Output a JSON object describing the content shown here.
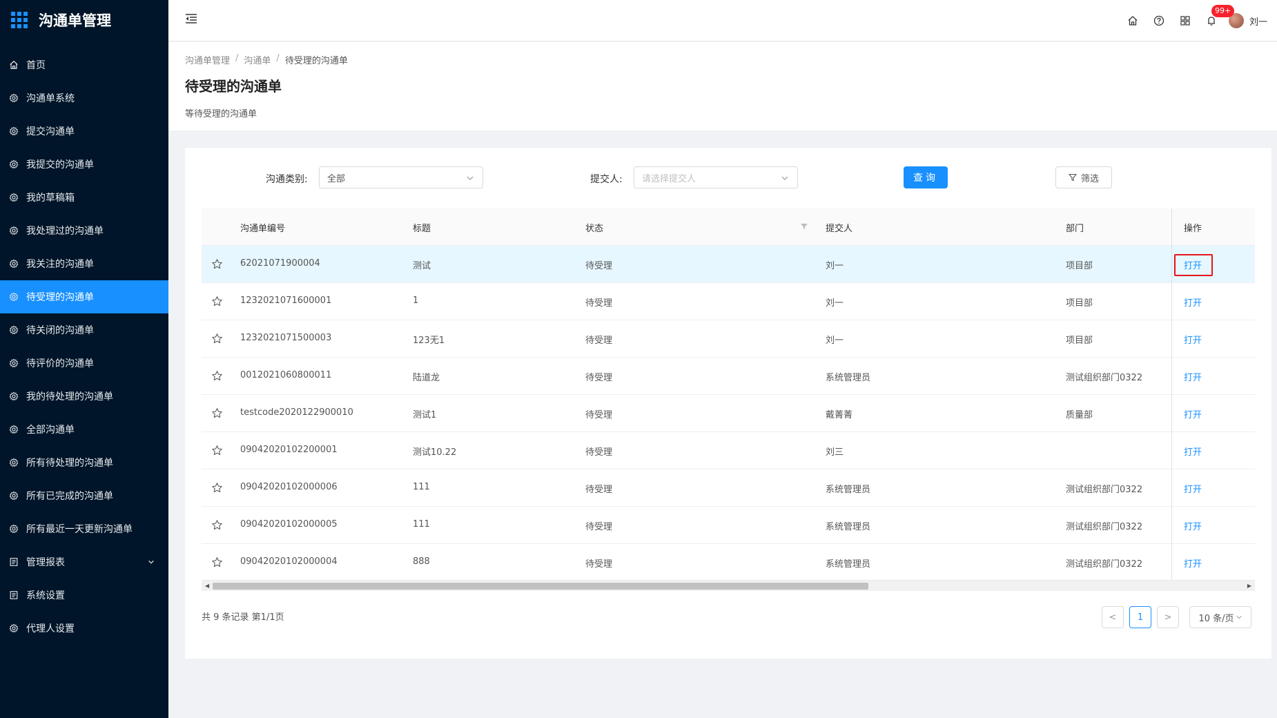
{
  "app": {
    "title": "沟通单管理"
  },
  "sidebar": {
    "items": [
      {
        "label": "首页",
        "icon": "home-icon"
      },
      {
        "label": "沟通单系统",
        "icon": "gear-icon"
      },
      {
        "label": "提交沟通单",
        "icon": "gear-icon"
      },
      {
        "label": "我提交的沟通单",
        "icon": "gear-icon"
      },
      {
        "label": "我的草稿箱",
        "icon": "gear-icon"
      },
      {
        "label": "我处理过的沟通单",
        "icon": "gear-icon"
      },
      {
        "label": "我关注的沟通单",
        "icon": "gear-icon"
      },
      {
        "label": "待受理的沟通单",
        "icon": "gear-icon",
        "active": true
      },
      {
        "label": "待关闭的沟通单",
        "icon": "gear-icon"
      },
      {
        "label": "待评价的沟通单",
        "icon": "gear-icon"
      },
      {
        "label": "我的待处理的沟通单",
        "icon": "gear-icon"
      },
      {
        "label": "全部沟通单",
        "icon": "gear-icon"
      },
      {
        "label": "所有待处理的沟通单",
        "icon": "gear-icon"
      },
      {
        "label": "所有已完成的沟通单",
        "icon": "gear-icon"
      },
      {
        "label": "所有最近一天更新沟通单",
        "icon": "gear-icon"
      },
      {
        "label": "管理报表",
        "icon": "report-icon",
        "expandable": true
      },
      {
        "label": "系统设置",
        "icon": "report-icon"
      },
      {
        "label": "代理人设置",
        "icon": "gear-icon"
      }
    ]
  },
  "header": {
    "notification_badge": "99+",
    "user_name": "刘一"
  },
  "breadcrumb": [
    "沟通单管理",
    "沟通单",
    "待受理的沟通单"
  ],
  "page": {
    "title": "待受理的沟通单",
    "description": "等待受理的沟通单"
  },
  "filters": {
    "category_label": "沟通类别:",
    "category_value": "全部",
    "submitter_label": "提交人:",
    "submitter_placeholder": "请选择提交人",
    "query_button": "查询",
    "filter_button": "筛选"
  },
  "table": {
    "columns": [
      "沟通单编号",
      "标题",
      "状态",
      "提交人",
      "部门",
      "操作"
    ],
    "rows": [
      {
        "id": "62021071900004",
        "title": "测试",
        "status": "待受理",
        "submitter": "刘一",
        "dept": "项目部",
        "action": "打开"
      },
      {
        "id": "1232021071600001",
        "title": "1",
        "status": "待受理",
        "submitter": "刘一",
        "dept": "项目部",
        "action": "打开"
      },
      {
        "id": "1232021071500003",
        "title": "123无1",
        "status": "待受理",
        "submitter": "刘一",
        "dept": "项目部",
        "action": "打开"
      },
      {
        "id": "0012021060800011",
        "title": "陆道龙",
        "status": "待受理",
        "submitter": "系统管理员",
        "dept": "测试组织部门0322",
        "action": "打开"
      },
      {
        "id": "testcode2020122900010",
        "title": "测试1",
        "status": "待受理",
        "submitter": "戴菁菁",
        "dept": "质量部",
        "action": "打开"
      },
      {
        "id": "09042020102200001",
        "title": "测试10.22",
        "status": "待受理",
        "submitter": "刘三",
        "dept": "",
        "action": "打开"
      },
      {
        "id": "09042020102000006",
        "title": "111",
        "status": "待受理",
        "submitter": "系统管理员",
        "dept": "测试组织部门0322",
        "action": "打开"
      },
      {
        "id": "09042020102000005",
        "title": "111",
        "status": "待受理",
        "submitter": "系统管理员",
        "dept": "测试组织部门0322",
        "action": "打开"
      },
      {
        "id": "09042020102000004",
        "title": "888",
        "status": "待受理",
        "submitter": "系统管理员",
        "dept": "测试组织部门0322",
        "action": "打开"
      }
    ]
  },
  "pagination": {
    "summary": "共 9 条记录 第1/1页",
    "current_page": "1",
    "prev": "<",
    "next": ">",
    "page_size": "10 条/页"
  },
  "colors": {
    "sidebar_bg": "#001529",
    "accent": "#1890ff",
    "highlight_box": "#e5141b"
  }
}
